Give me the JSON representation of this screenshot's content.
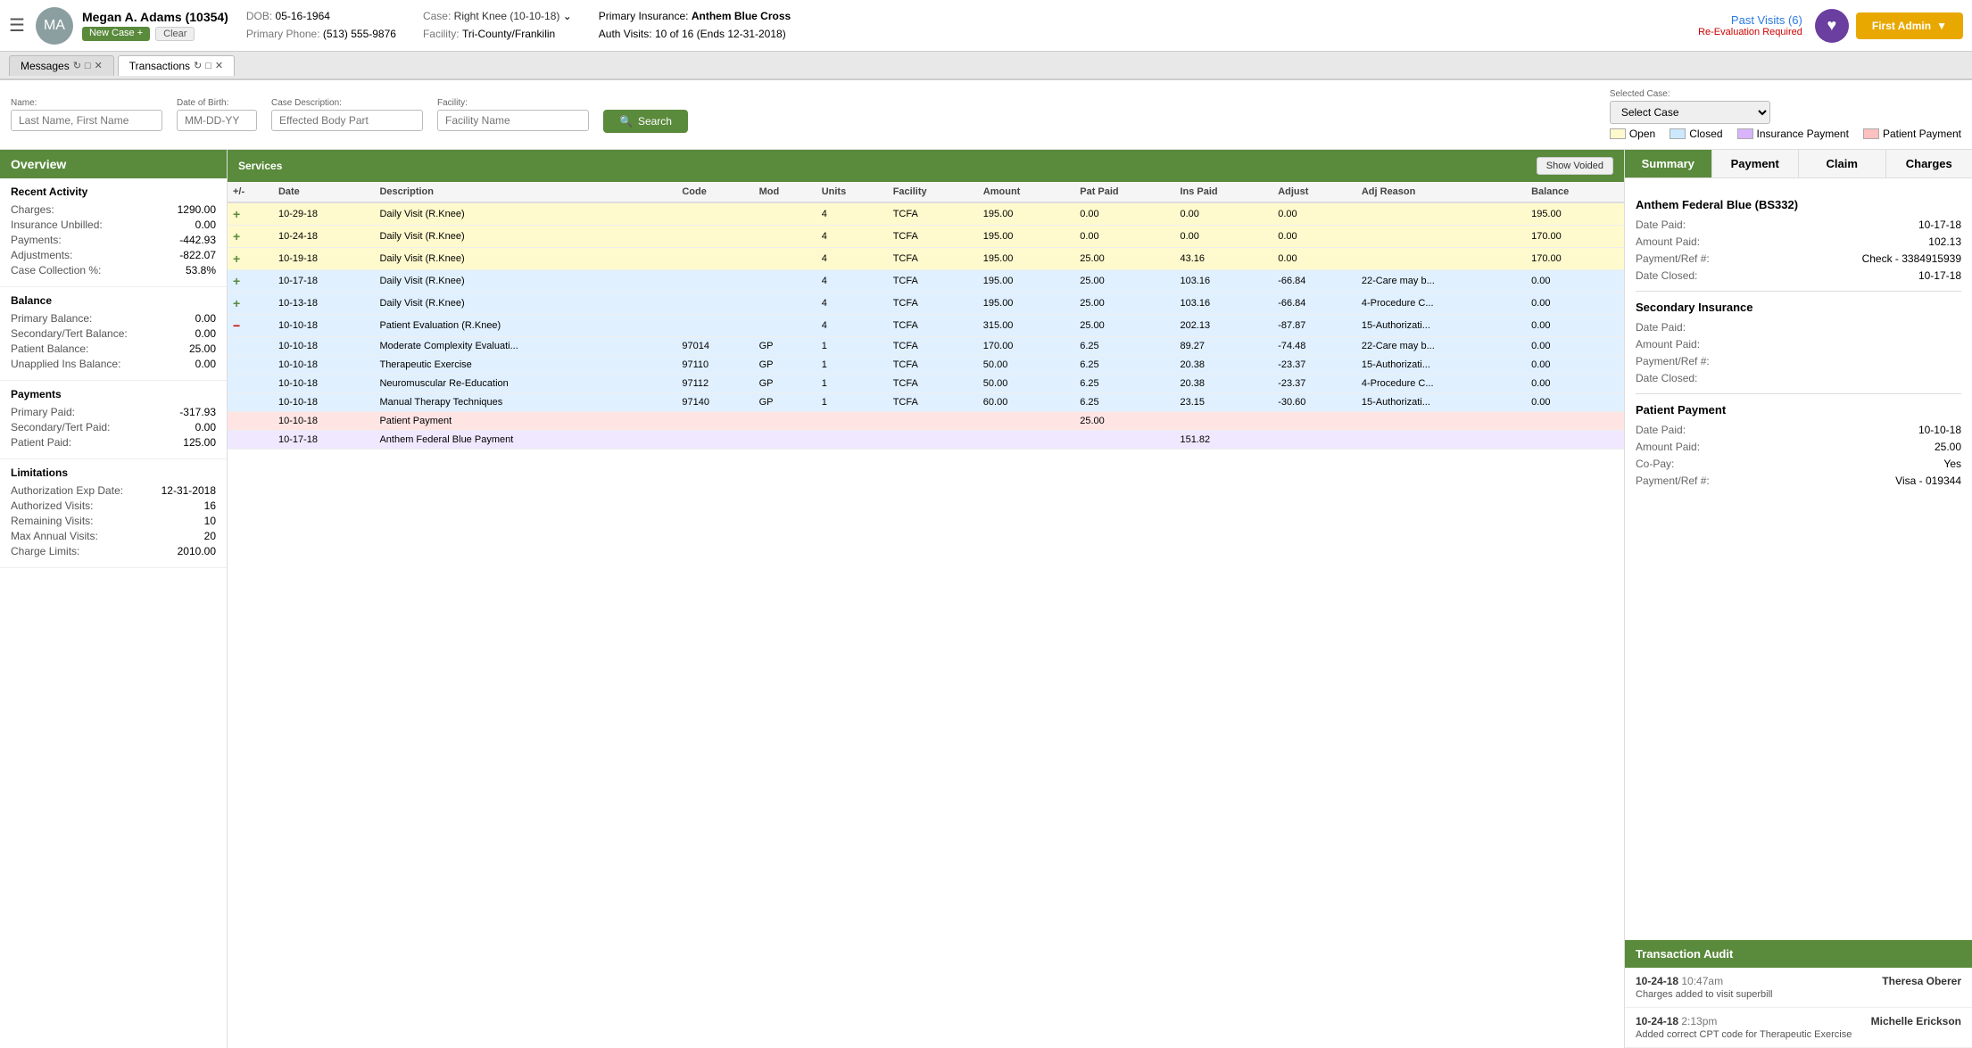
{
  "topbar": {
    "hamburger": "☰",
    "patient_name": "Megan A. Adams (10354)",
    "badge_new": "New Case +",
    "badge_clear": "Clear",
    "dob_label": "DOB:",
    "dob": "05-16-1964",
    "phone_label": "Primary Phone:",
    "phone": "(513) 555-9876",
    "case_label": "Case:",
    "case": "Right Knee (10-10-18)",
    "facility_label": "Facility:",
    "facility": "Tri-County/Frankilin",
    "ins_label": "Primary Insurance:",
    "ins": "Anthem Blue Cross",
    "auth_label": "Auth Visits:",
    "auth": "10 of 16 (Ends 12-31-2018)",
    "past_visits_label": "Past Visits (6)",
    "reeval": "Re-Evaluation Required",
    "first_admin": "First Admin"
  },
  "tabs": [
    {
      "label": "Messages",
      "active": false
    },
    {
      "label": "Transactions",
      "active": true
    }
  ],
  "searchbar": {
    "name_label": "Name:",
    "name_placeholder": "Last Name, First Name",
    "dob_label": "Date of Birth:",
    "dob_placeholder": "MM-DD-YY",
    "case_desc_label": "Case Description:",
    "case_desc_placeholder": "Effected Body Part",
    "facility_label": "Facility:",
    "facility_placeholder": "Facility Name",
    "search_label": "Search",
    "selected_case_label": "Selected Case:",
    "selected_case_placeholder": "Select Case",
    "legend": [
      {
        "label": "Open",
        "color": "#fffacd"
      },
      {
        "label": "Closed",
        "color": "#cce8ff"
      },
      {
        "label": "Insurance Payment",
        "color": "#d8b4fe"
      },
      {
        "label": "Patient Payment",
        "color": "#ffc0c0"
      }
    ]
  },
  "sidebar": {
    "header": "Overview",
    "recent_activity": {
      "title": "Recent Activity",
      "rows": [
        {
          "label": "Charges:",
          "value": "1290.00"
        },
        {
          "label": "Insurance Unbilled:",
          "value": "0.00"
        },
        {
          "label": "Payments:",
          "value": "-442.93"
        },
        {
          "label": "Adjustments:",
          "value": "-822.07"
        },
        {
          "label": "Case Collection %:",
          "value": "53.8%"
        }
      ]
    },
    "balance": {
      "title": "Balance",
      "rows": [
        {
          "label": "Primary Balance:",
          "value": "0.00"
        },
        {
          "label": "Secondary/Tert Balance:",
          "value": "0.00"
        },
        {
          "label": "Patient Balance:",
          "value": "25.00"
        },
        {
          "label": "Unapplied Ins Balance:",
          "value": "0.00"
        }
      ]
    },
    "payments": {
      "title": "Payments",
      "rows": [
        {
          "label": "Primary Paid:",
          "value": "-317.93"
        },
        {
          "label": "Secondary/Tert Paid:",
          "value": "0.00"
        },
        {
          "label": "Patient Paid:",
          "value": "125.00"
        }
      ]
    },
    "limitations": {
      "title": "Limitations",
      "rows": [
        {
          "label": "Authorization Exp Date:",
          "value": "12-31-2018"
        },
        {
          "label": "Authorized Visits:",
          "value": "16"
        },
        {
          "label": "Remaining Visits:",
          "value": "10"
        },
        {
          "label": "Max Annual Visits:",
          "value": "20"
        },
        {
          "label": "Charge Limits:",
          "value": "2010.00"
        }
      ]
    }
  },
  "services": {
    "header": "Services",
    "show_voided": "Show Voided",
    "columns": [
      "+/-",
      "Date",
      "Description",
      "Code",
      "Mod",
      "Units",
      "Facility",
      "Amount",
      "Pat Paid",
      "Ins Paid",
      "Adjust",
      "Adj Reason",
      "Balance"
    ],
    "rows": [
      {
        "type": "yellow",
        "toggle": "+",
        "date": "10-29-18",
        "desc": "Daily Visit (R.Knee)",
        "code": "",
        "mod": "",
        "units": "4",
        "facility": "TCFA",
        "amount": "195.00",
        "pat_paid": "0.00",
        "ins_paid": "0.00",
        "adjust": "0.00",
        "adj_reason": "",
        "balance": "195.00"
      },
      {
        "type": "yellow",
        "toggle": "+",
        "date": "10-24-18",
        "desc": "Daily Visit (R.Knee)",
        "code": "",
        "mod": "",
        "units": "4",
        "facility": "TCFA",
        "amount": "195.00",
        "pat_paid": "0.00",
        "ins_paid": "0.00",
        "adjust": "0.00",
        "adj_reason": "",
        "balance": "170.00"
      },
      {
        "type": "yellow",
        "toggle": "+",
        "date": "10-19-18",
        "desc": "Daily Visit (R.Knee)",
        "code": "",
        "mod": "",
        "units": "4",
        "facility": "TCFA",
        "amount": "195.00",
        "pat_paid": "25.00",
        "ins_paid": "43.16",
        "adjust": "0.00",
        "adj_reason": "",
        "balance": "170.00"
      },
      {
        "type": "blue",
        "toggle": "+",
        "date": "10-17-18",
        "desc": "Daily Visit (R.Knee)",
        "code": "",
        "mod": "",
        "units": "4",
        "facility": "TCFA",
        "amount": "195.00",
        "pat_paid": "25.00",
        "ins_paid": "103.16",
        "adjust": "-66.84",
        "adj_reason": "22-Care may b...",
        "balance": "0.00"
      },
      {
        "type": "blue",
        "toggle": "+",
        "date": "10-13-18",
        "desc": "Daily Visit (R.Knee)",
        "code": "",
        "mod": "",
        "units": "4",
        "facility": "TCFA",
        "amount": "195.00",
        "pat_paid": "25.00",
        "ins_paid": "103.16",
        "adjust": "-66.84",
        "adj_reason": "4-Procedure C...",
        "balance": "0.00"
      },
      {
        "type": "blue",
        "toggle": "−",
        "date": "10-10-18",
        "desc": "Patient Evaluation (R.Knee)",
        "code": "",
        "mod": "",
        "units": "4",
        "facility": "TCFA",
        "amount": "315.00",
        "pat_paid": "25.00",
        "ins_paid": "202.13",
        "adjust": "-87.87",
        "adj_reason": "15-Authorizati...",
        "balance": "0.00"
      },
      {
        "type": "blue",
        "toggle": "",
        "date": "10-10-18",
        "desc": "Moderate Complexity Evaluati...",
        "code": "97014",
        "mod": "GP",
        "units": "1",
        "facility": "TCFA",
        "amount": "170.00",
        "pat_paid": "6.25",
        "ins_paid": "89.27",
        "adjust": "-74.48",
        "adj_reason": "22-Care may b...",
        "balance": "0.00"
      },
      {
        "type": "blue",
        "toggle": "",
        "date": "10-10-18",
        "desc": "Therapeutic Exercise",
        "code": "97110",
        "mod": "GP",
        "units": "1",
        "facility": "TCFA",
        "amount": "50.00",
        "pat_paid": "6.25",
        "ins_paid": "20.38",
        "adjust": "-23.37",
        "adj_reason": "15-Authorizati...",
        "balance": "0.00"
      },
      {
        "type": "blue",
        "toggle": "",
        "date": "10-10-18",
        "desc": "Neuromuscular Re-Education",
        "code": "97112",
        "mod": "GP",
        "units": "1",
        "facility": "TCFA",
        "amount": "50.00",
        "pat_paid": "6.25",
        "ins_paid": "20.38",
        "adjust": "-23.37",
        "adj_reason": "4-Procedure C...",
        "balance": "0.00"
      },
      {
        "type": "blue",
        "toggle": "",
        "date": "10-10-18",
        "desc": "Manual Therapy Techniques",
        "code": "97140",
        "mod": "GP",
        "units": "1",
        "facility": "TCFA",
        "amount": "60.00",
        "pat_paid": "6.25",
        "ins_paid": "23.15",
        "adjust": "-30.60",
        "adj_reason": "15-Authorizati...",
        "balance": "0.00"
      },
      {
        "type": "pink",
        "toggle": "",
        "date": "10-10-18",
        "desc": "Patient Payment",
        "code": "",
        "mod": "",
        "units": "",
        "facility": "",
        "amount": "",
        "pat_paid": "25.00",
        "ins_paid": "",
        "adjust": "",
        "adj_reason": "",
        "balance": ""
      },
      {
        "type": "lavender",
        "toggle": "",
        "date": "10-17-18",
        "desc": "Anthem Federal Blue Payment",
        "code": "",
        "mod": "",
        "units": "",
        "facility": "",
        "amount": "",
        "pat_paid": "",
        "ins_paid": "151.82",
        "adjust": "",
        "adj_reason": "",
        "balance": ""
      }
    ]
  },
  "right_panel": {
    "tabs": [
      "Summary",
      "Payment",
      "Claim",
      "Charges"
    ],
    "active_tab": "Summary",
    "primary_ins": {
      "title": "Anthem Federal Blue (BS332)",
      "date_paid_label": "Date Paid:",
      "date_paid": "10-17-18",
      "amount_paid_label": "Amount Paid:",
      "amount_paid": "102.13",
      "ref_label": "Payment/Ref #:",
      "ref": "Check - 3384915939",
      "date_closed_label": "Date Closed:",
      "date_closed": "10-17-18"
    },
    "secondary_ins": {
      "title": "Secondary Insurance",
      "date_paid_label": "Date Paid:",
      "date_paid": "",
      "amount_paid_label": "Amount Paid:",
      "amount_paid": "",
      "ref_label": "Payment/Ref #:",
      "ref": "",
      "date_closed_label": "Date Closed:",
      "date_closed": ""
    },
    "patient_payment": {
      "title": "Patient Payment",
      "date_paid_label": "Date Paid:",
      "date_paid": "10-10-18",
      "amount_paid_label": "Amount Paid:",
      "amount_paid": "25.00",
      "copay_label": "Co-Pay:",
      "copay": "Yes",
      "ref_label": "Payment/Ref #:",
      "ref": "Visa - 019344"
    }
  },
  "audit": {
    "header": "Transaction Audit",
    "entries": [
      {
        "date": "10-24-18",
        "time": "10:47am",
        "user": "Theresa Oberer",
        "desc": "Charges added to visit superbill"
      },
      {
        "date": "10-24-18",
        "time": "2:13pm",
        "user": "Michelle Erickson",
        "desc": "Added correct CPT code for Therapeutic Exercise"
      }
    ]
  }
}
